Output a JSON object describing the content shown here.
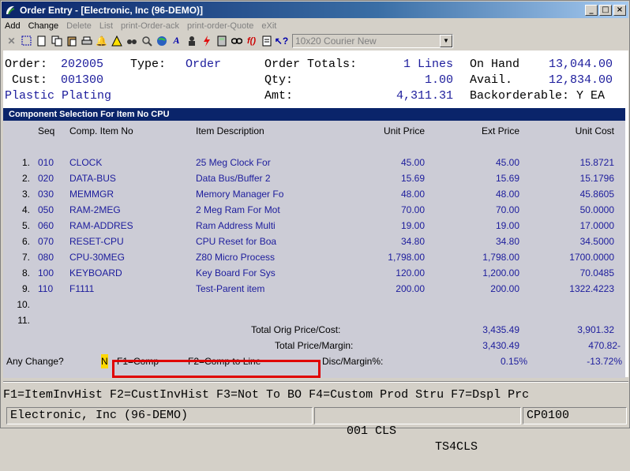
{
  "window": {
    "title": "Order Entry - [Electronic, Inc (96-DEMO)]"
  },
  "menu": [
    {
      "label": "Add",
      "enabled": true
    },
    {
      "label": "Change",
      "enabled": true
    },
    {
      "label": "Delete",
      "enabled": false
    },
    {
      "label": "List",
      "enabled": false
    },
    {
      "label": "print-Order-ack",
      "enabled": false
    },
    {
      "label": "print-order-Quote",
      "enabled": false
    },
    {
      "label": "eXit",
      "enabled": false
    }
  ],
  "toolbar": {
    "font_combo": "10x20 Courier New"
  },
  "header": {
    "order_label": "Order:",
    "order_value": "202005",
    "type_label": "Type:",
    "type_value": "Order",
    "totals_label": "Order Totals:",
    "lines_value": "1 Lines",
    "onhand_label": "On Hand",
    "onhand_value": "13,044.00",
    "cust_label": "Cust:",
    "cust_value": "001300",
    "qty_label": "Qty:",
    "qty_value": "1.00",
    "avail_label": "Avail.",
    "avail_value": "12,834.00",
    "customer_name": "Plastic Plating",
    "amt_label": "Amt:",
    "amt_value": "4,311.31",
    "backorder_label": "Backorderable: Y EA"
  },
  "component": {
    "title": "Component Selection For Item No CPU",
    "columns": [
      "Seq",
      "Comp. Item No",
      "Item Description",
      "Unit Price",
      "Ext Price",
      "Unit Cost"
    ],
    "rows": [
      {
        "n": "1.",
        "seq": "010",
        "item": "CLOCK",
        "desc": "25 Meg Clock For",
        "unit": "45.00",
        "ext": "45.00",
        "cost": "15.8721"
      },
      {
        "n": "2.",
        "seq": "020",
        "item": "DATA-BUS",
        "desc": "Data Bus/Buffer 2",
        "unit": "15.69",
        "ext": "15.69",
        "cost": "15.1796"
      },
      {
        "n": "3.",
        "seq": "030",
        "item": "MEMMGR",
        "desc": "Memory Manager Fo",
        "unit": "48.00",
        "ext": "48.00",
        "cost": "45.8605"
      },
      {
        "n": "4.",
        "seq": "050",
        "item": "RAM-2MEG",
        "desc": "2 Meg Ram For Mot",
        "unit": "70.00",
        "ext": "70.00",
        "cost": "50.0000"
      },
      {
        "n": "5.",
        "seq": "060",
        "item": "RAM-ADDRES",
        "desc": "Ram Address Multi",
        "unit": "19.00",
        "ext": "19.00",
        "cost": "17.0000"
      },
      {
        "n": "6.",
        "seq": "070",
        "item": "RESET-CPU",
        "desc": "CPU Reset for Boa",
        "unit": "34.80",
        "ext": "34.80",
        "cost": "34.5000"
      },
      {
        "n": "7.",
        "seq": "080",
        "item": "CPU-30MEG",
        "desc": "Z80 Micro Process",
        "unit": "1,798.00",
        "ext": "1,798.00",
        "cost": "1700.0000"
      },
      {
        "n": "8.",
        "seq": "100",
        "item": "KEYBOARD",
        "desc": "Key Board For Sys",
        "unit": "120.00",
        "ext": "1,200.00",
        "cost": "70.0485"
      },
      {
        "n": "9.",
        "seq": "110",
        "item": "F1111",
        "desc": "Test-Parent item",
        "unit": "200.00",
        "ext": "200.00",
        "cost": "1322.4223"
      },
      {
        "n": "10.",
        "seq": "",
        "item": "",
        "desc": "",
        "unit": "",
        "ext": "",
        "cost": ""
      },
      {
        "n": "11.",
        "seq": "",
        "item": "",
        "desc": "",
        "unit": "",
        "ext": "",
        "cost": ""
      }
    ],
    "total_orig_label": "Total Orig Price/Cost:",
    "total_orig_price": "3,435.49",
    "total_orig_cost": "3,901.32",
    "total_margin_label": "Total Price/Margin:",
    "total_price": "3,430.49",
    "total_margin": "470.82-",
    "change_prompt": "Any Change?",
    "change_value": "N",
    "f1_hint": "F1=Comp",
    "f2_hint": "F2=Comp to Line",
    "disc_label": "Disc/Margin%:",
    "disc_value": "0.15%",
    "margin_pct": "-13.72%"
  },
  "fkeys": "F1=ItemInvHist F2=CustInvHist F3=Not To BO F4=Custom Prod Stru F7=Dspl Prc",
  "status": {
    "company": "Electronic, Inc (96-DEMO)",
    "cls": "001 CLS",
    "terminal": "TS4CLS",
    "program": "CP0100"
  }
}
